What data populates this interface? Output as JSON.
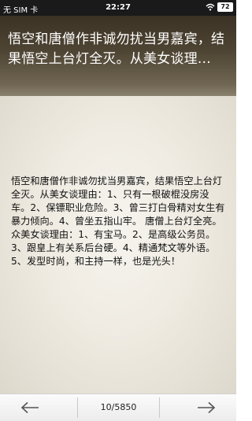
{
  "status_bar": {
    "carrier": "无 SIM 卡",
    "time": "22:27",
    "battery": "72"
  },
  "header": {
    "title": "悟空和唐僧作非诚勿扰当男嘉宾，结果悟空上台灯全灭。从美女谈理…"
  },
  "content": {
    "body": "悟空和唐僧作非诚勿扰当男嘉宾，结果悟空上台灯全灭。从美女谈理由：1、只有一根破棍没房没车。2、保镖职业危险。3、曾三打白骨精对女生有暴力倾向。4、曾坐五指山牢。 唐僧上台灯全亮。众美女谈理由：1、有宝马。2、是高级公务员。3、跟皇上有关系后台硬。4、精通梵文等外语。5、发型时尚，和主持一样，也是光头！"
  },
  "bottom_bar": {
    "page_indicator": "10/5850",
    "prev_icon": "arrow-left-icon",
    "next_icon": "arrow-right-icon"
  }
}
